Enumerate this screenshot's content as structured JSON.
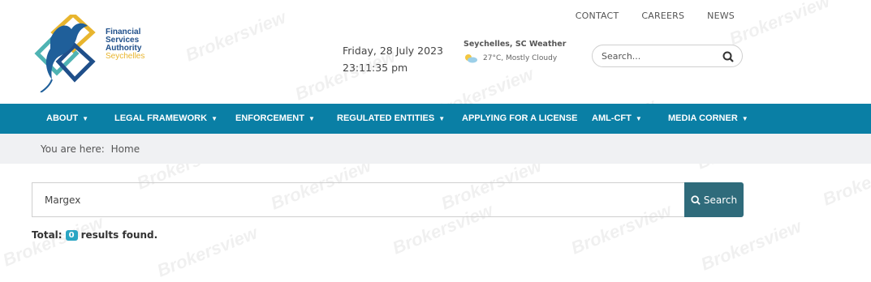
{
  "topnav": {
    "contact": "CONTACT",
    "careers": "CAREERS",
    "news": "NEWS"
  },
  "logo": {
    "line1": "Financial",
    "line2": "Services",
    "line3": "Authority",
    "line4": "Seychelles"
  },
  "datetime": {
    "date": "Friday, 28 July 2023",
    "time": "23:11:35 pm"
  },
  "weather": {
    "title": "Seychelles, SC Weather",
    "condition": "27°C, Mostly Cloudy"
  },
  "search_top": {
    "placeholder": "Search..."
  },
  "mainnav": [
    {
      "label": "ABOUT",
      "dropdown": true
    },
    {
      "label": "LEGAL FRAMEWORK",
      "dropdown": true
    },
    {
      "label": "ENFORCEMENT",
      "dropdown": true
    },
    {
      "label": "REGULATED ENTITIES",
      "dropdown": true
    },
    {
      "label": "APPLYING FOR A LICENSE",
      "dropdown": false
    },
    {
      "label": "AML-CFT",
      "dropdown": true
    },
    {
      "label": "MEDIA CORNER",
      "dropdown": true
    }
  ],
  "breadcrumb": {
    "prefix": "You are here:",
    "home": "Home"
  },
  "search": {
    "value": "Margex",
    "button": "Search"
  },
  "results": {
    "prefix": "Total:",
    "count": "0",
    "suffix": "results found."
  },
  "watermark": "Brokersview",
  "colors": {
    "nav": "#0a7fa5",
    "button": "#2f6b7b",
    "badge": "#2aa5c3"
  }
}
